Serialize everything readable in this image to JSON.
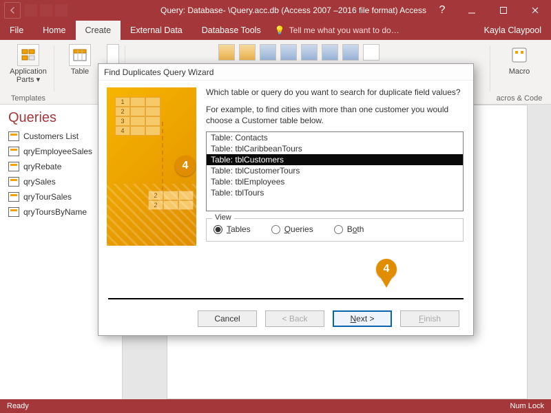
{
  "titlebar": {
    "title": "Query: Database- \\Query.acc.db (Access 2007 –2016 file format) Access"
  },
  "ribbon_tabs": {
    "file": "File",
    "home": "Home",
    "create": "Create",
    "external": "External Data",
    "dbtools": "Database Tools",
    "tell": "Tell me what you want to do…",
    "user": "Kayla Claypool"
  },
  "ribbon": {
    "app_parts": "Application\nParts ▾",
    "templates": "Templates",
    "table": "Table",
    "macro": "Macro",
    "macros_code": "acros & Code"
  },
  "nav": {
    "heading": "Queries",
    "items": [
      "Customers List",
      "qryEmployeeSales",
      "qryRebate",
      "qrySales",
      "qryTourSales",
      "qryToursByName"
    ]
  },
  "dialog": {
    "title": "Find Duplicates Query Wizard",
    "question": "Which table or query do you want to search for duplicate field values?",
    "example": "For example, to find cities with more than one customer you would choose a Customer table below.",
    "list": [
      "Table: Contacts",
      "Table: tblCaribbeanTours",
      "Table: tblCustomers",
      "Table: tblCustomerTours",
      "Table: tblEmployees",
      "Table: tblTours"
    ],
    "selected_index": 2,
    "view_legend": "View",
    "radio_tables": "Tables",
    "radio_queries": "Queries",
    "radio_both": "Both",
    "btn_cancel": "Cancel",
    "btn_back": "< Back",
    "btn_next": "Next >",
    "btn_finish": "Finish"
  },
  "status": {
    "left": "Ready",
    "right": "Num Lock"
  },
  "callouts": {
    "a": "4",
    "b": "4"
  }
}
